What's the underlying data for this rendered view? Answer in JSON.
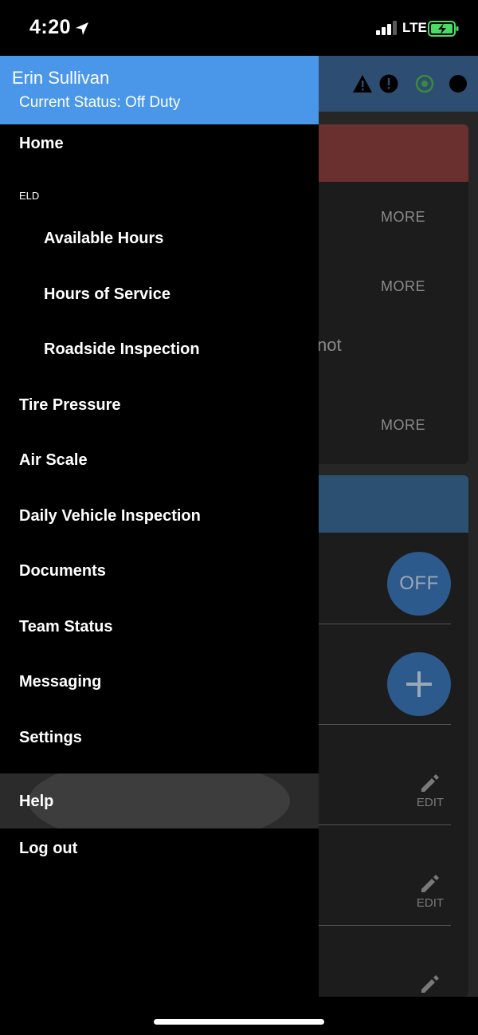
{
  "status_bar": {
    "time": "4:20",
    "network": "LTE",
    "location_icon": "location-arrow-icon",
    "signal_icon": "cellular-signal-icon",
    "battery_icon": "battery-charging-icon",
    "battery_color": "#4cd964"
  },
  "drawer": {
    "user_name": "Erin Sullivan",
    "current_status": "Current Status: Off Duty",
    "header_color": "#4a97e9",
    "section_eld": "ELD",
    "items": [
      {
        "label": "Home"
      },
      {
        "label": "Available Hours"
      },
      {
        "label": "Hours of Service"
      },
      {
        "label": "Roadside Inspection"
      },
      {
        "label": "Tire Pressure"
      },
      {
        "label": "Air Scale"
      },
      {
        "label": "Daily Vehicle Inspection"
      },
      {
        "label": "Documents"
      },
      {
        "label": "Team Status"
      },
      {
        "label": "Messaging"
      },
      {
        "label": "Settings"
      },
      {
        "label": "Help"
      },
      {
        "label": "Log out"
      }
    ],
    "active_item": "Help"
  },
  "background": {
    "more_labels": [
      "MORE",
      "MORE",
      "MORE"
    ],
    "partial_text": "not",
    "duty_button": "OFF",
    "edit_labels": [
      "EDIT",
      "EDIT"
    ],
    "topbar_icons": [
      "warning-icon",
      "alert-circle-icon",
      "gps-icon",
      "status-dot-icon"
    ]
  }
}
